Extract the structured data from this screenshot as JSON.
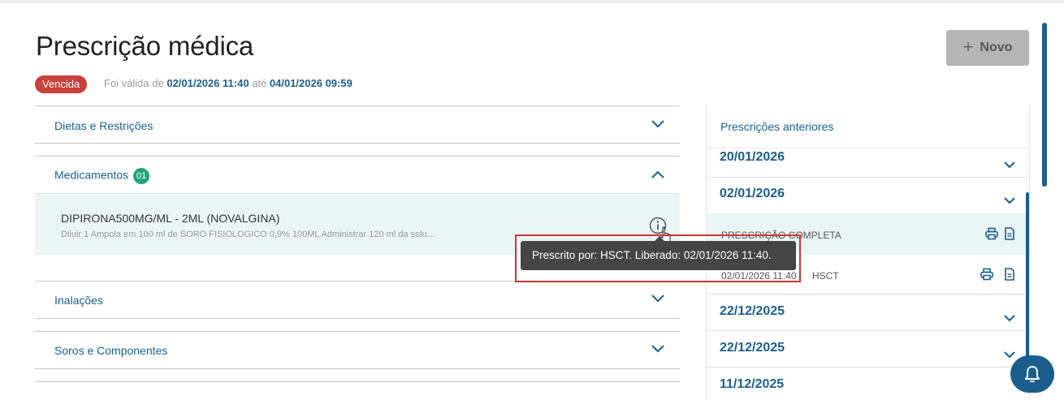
{
  "header": {
    "title": "Prescrição médica",
    "new_button_icon": "plus-icon",
    "new_button_label": "Novo"
  },
  "status": {
    "badge": "Vencida",
    "validity_prefix": "Foi válida de",
    "valid_from": "02/01/2026 11:40",
    "validity_mid": "até",
    "valid_to": "04/01/2026 09:59"
  },
  "sections": [
    {
      "title": "Dietas e Restrições",
      "expanded": false
    },
    {
      "title": "Medicamentos",
      "count": "01",
      "expanded": true
    },
    {
      "title": "Inalações",
      "expanded": false
    },
    {
      "title": "Soros e Componentes",
      "expanded": false
    }
  ],
  "medication": {
    "name": "DIPIRONA500MG/ML - 2ML (NOVALGINA)",
    "description": "Diluir 1 Ampola em 100 ml de SORO FISIOLOGICO 0,9% 100ML Administrar 120 ml da solu..."
  },
  "tooltip": {
    "text": "Prescrito por: HSCT. Liberado: 02/01/2026 11:40."
  },
  "previous": {
    "title": "Prescrições anteriores",
    "dates": [
      "20/01/2026",
      "02/01/2026",
      "22/12/2025",
      "22/12/2025",
      "11/12/2025"
    ],
    "expanded_item": {
      "label": "PRESCRIÇÃO COMPLETA",
      "time": "02/01/2026 11:40",
      "prescriber": "HSCT"
    }
  },
  "colors": {
    "accent": "#1b5e8e",
    "danger": "#c8413b",
    "success": "#22a57e",
    "row_highlight": "#eaf5f5",
    "tooltip_bg": "#454545"
  }
}
